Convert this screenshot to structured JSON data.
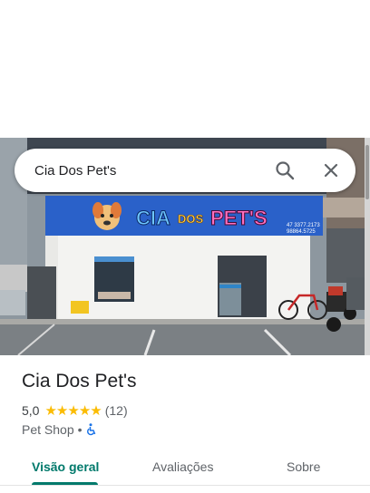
{
  "colors": {
    "accent": "#00796b",
    "star": "#fbbc04",
    "sign_blue": "#2a61c9",
    "sign_pink": "#e040a0",
    "accessibility_blue": "#1a73e8"
  },
  "search": {
    "value": "Cia Dos Pet's",
    "search_icon": "search-icon",
    "close_icon": "close-icon"
  },
  "photo": {
    "sign_left": "CIA",
    "sign_middle": "DOS",
    "sign_right": "PET'S",
    "phone_1": "47 3377.2173",
    "phone_2": "98864.5725"
  },
  "place": {
    "name": "Cia Dos Pet's",
    "rating": "5,0",
    "stars": 5,
    "review_count": "(12)",
    "category": "Pet Shop",
    "separator": "•",
    "accessible_icon": "wheelchair-accessible-icon"
  },
  "tabs": [
    {
      "label": "Visão geral",
      "active": true
    },
    {
      "label": "Avaliações",
      "active": false
    },
    {
      "label": "Sobre",
      "active": false
    }
  ]
}
